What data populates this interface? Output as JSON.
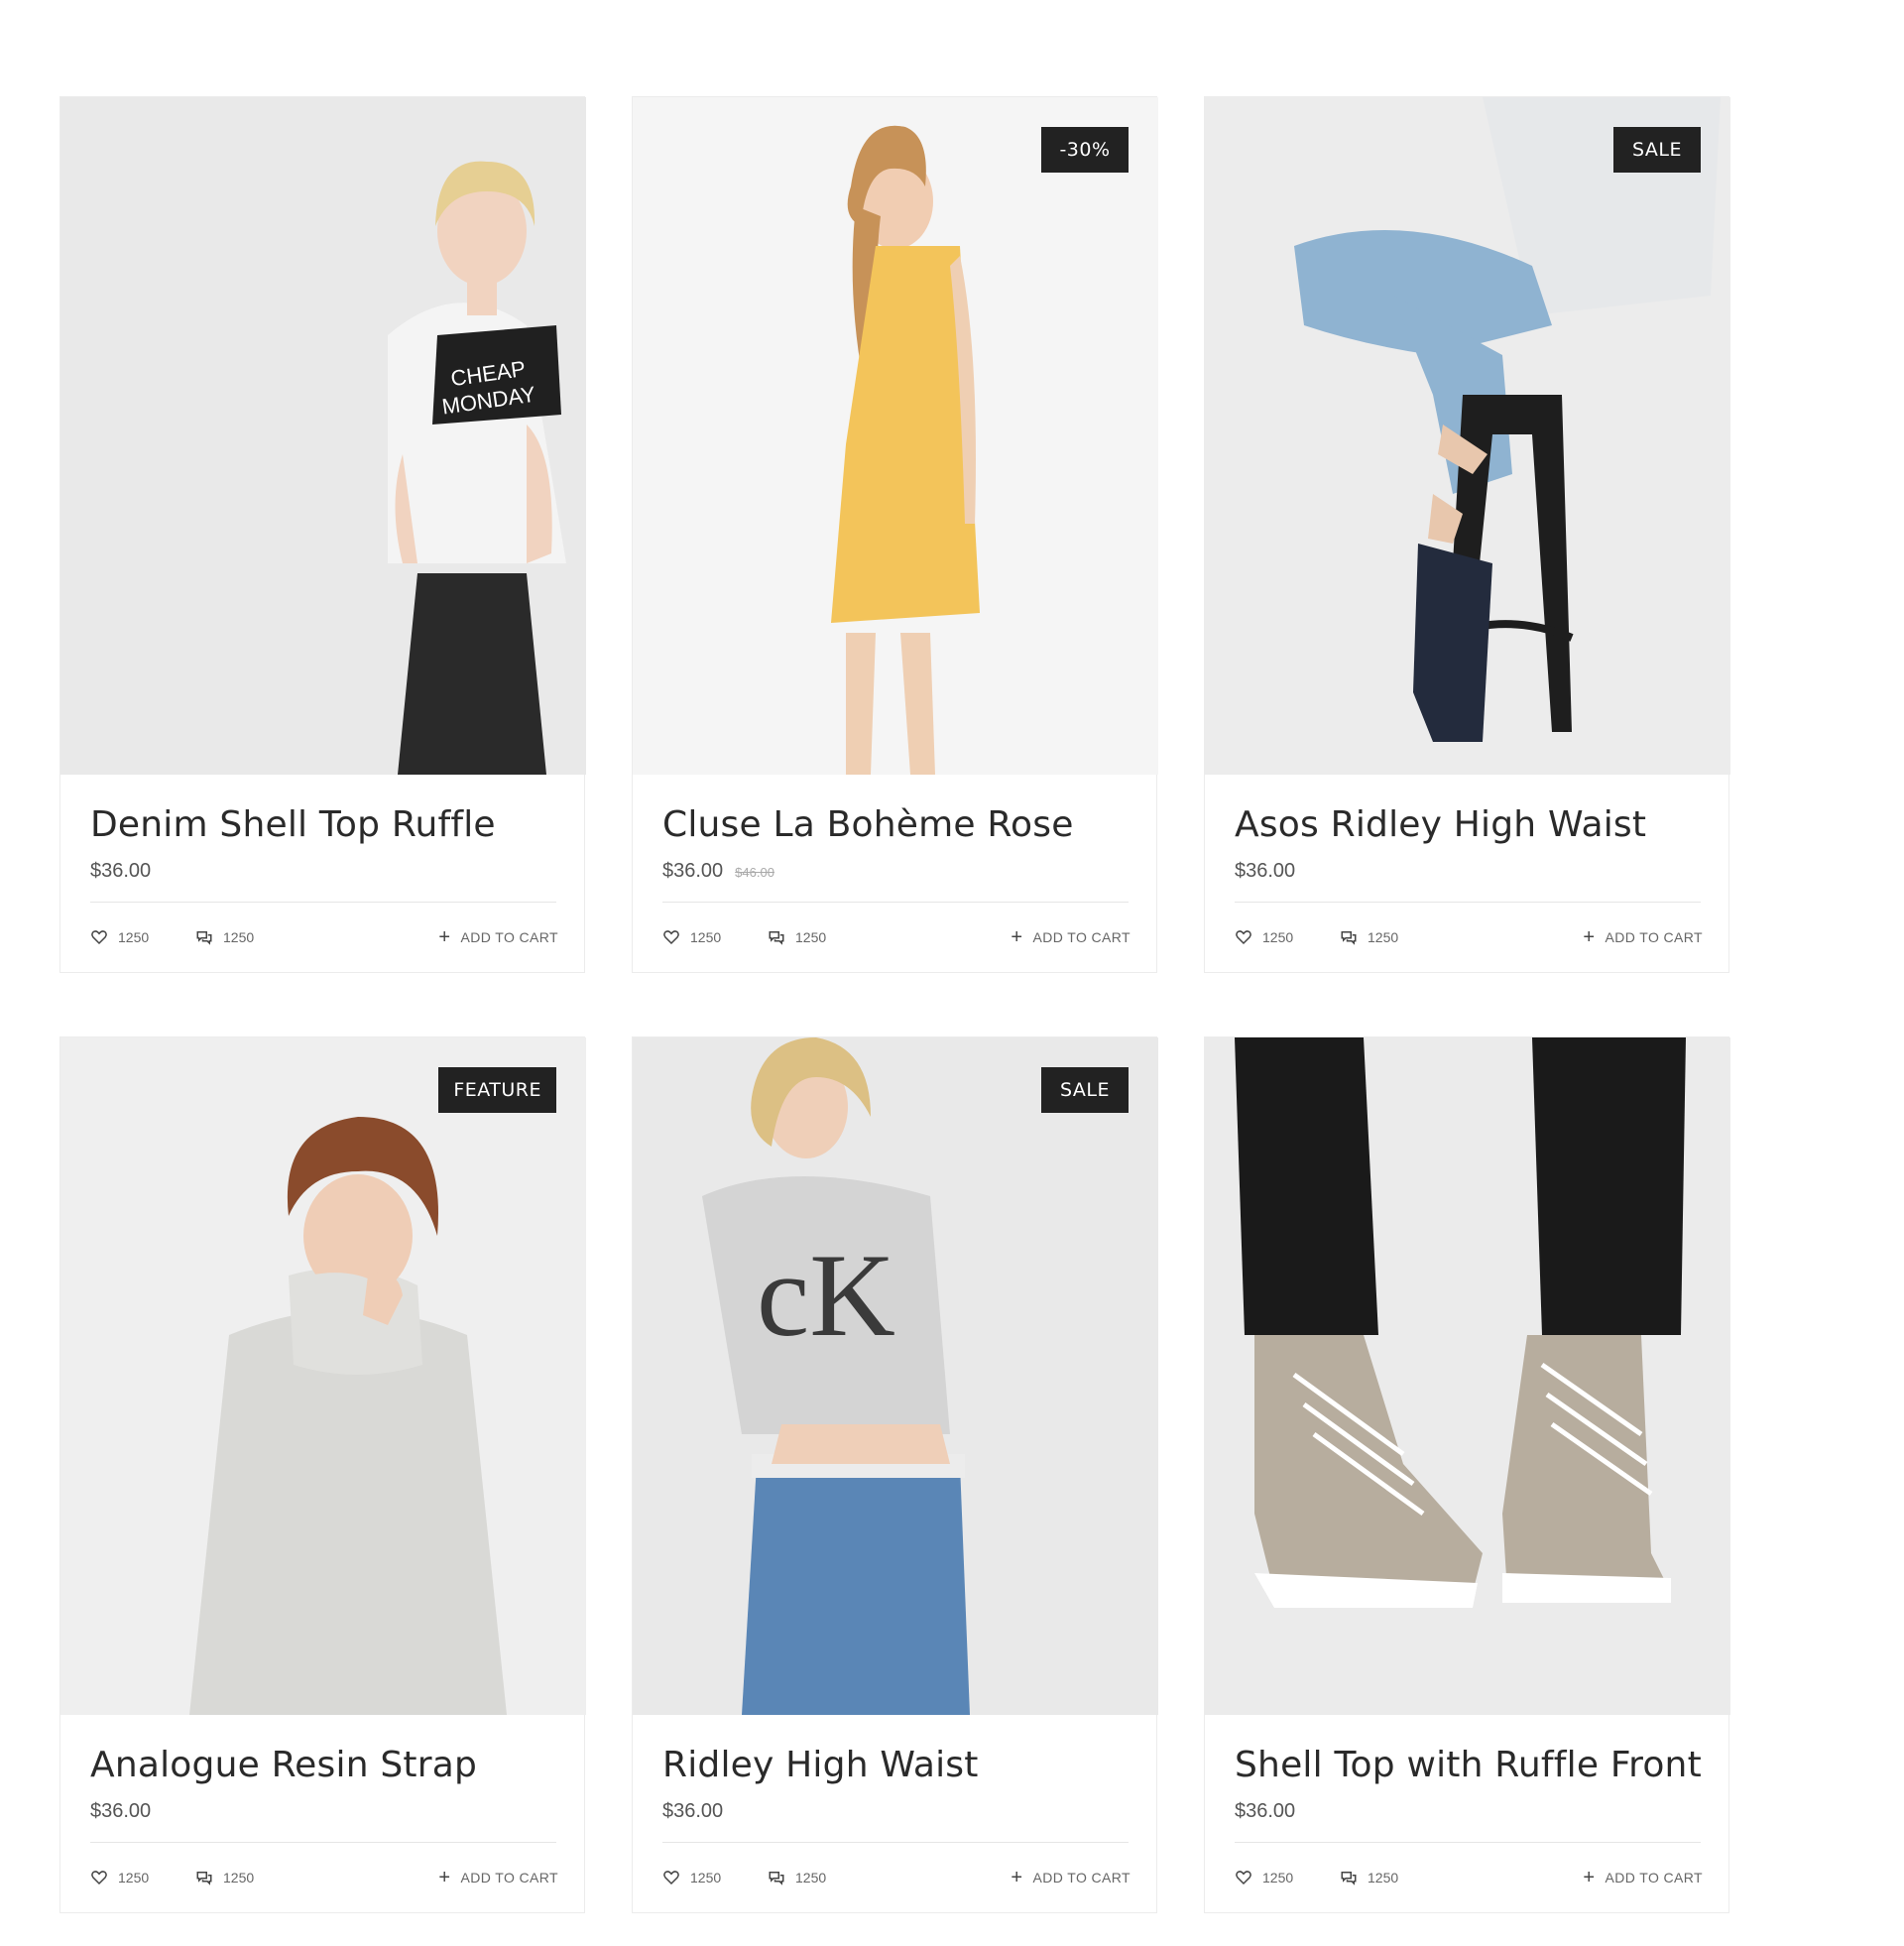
{
  "products": [
    {
      "title": "Denim Shell Top Ruffle",
      "price": "$36.00",
      "old_price": "",
      "badge": "",
      "likes": "1250",
      "comments": "1250",
      "cart_label": "ADD TO CART"
    },
    {
      "title": "Cluse La Bohème Rose",
      "price": "$36.00",
      "old_price": "$46.00",
      "badge": "-30%",
      "likes": "1250",
      "comments": "1250",
      "cart_label": "ADD TO CART"
    },
    {
      "title": "Asos Ridley High Waist",
      "price": "$36.00",
      "old_price": "",
      "badge": "SALE",
      "likes": "1250",
      "comments": "1250",
      "cart_label": "ADD TO CART"
    },
    {
      "title": "Analogue Resin Strap",
      "price": "$36.00",
      "old_price": "",
      "badge": "FEATURE",
      "likes": "1250",
      "comments": "1250",
      "cart_label": "ADD TO CART"
    },
    {
      "title": "Ridley High Waist",
      "price": "$36.00",
      "old_price": "",
      "badge": "SALE",
      "likes": "1250",
      "comments": "1250",
      "cart_label": "ADD TO CART"
    },
    {
      "title": "Shell Top with Ruffle Front",
      "price": "$36.00",
      "old_price": "",
      "badge": "",
      "likes": "1250",
      "comments": "1250",
      "cart_label": "ADD TO CART"
    }
  ],
  "icons": {
    "like": "heart-icon",
    "comment": "comments-icon",
    "cart": "plus-icon"
  },
  "colors": {
    "badge_bg": "#222222",
    "badge_text": "#ffffff",
    "image_bg": "#eeeeee"
  }
}
